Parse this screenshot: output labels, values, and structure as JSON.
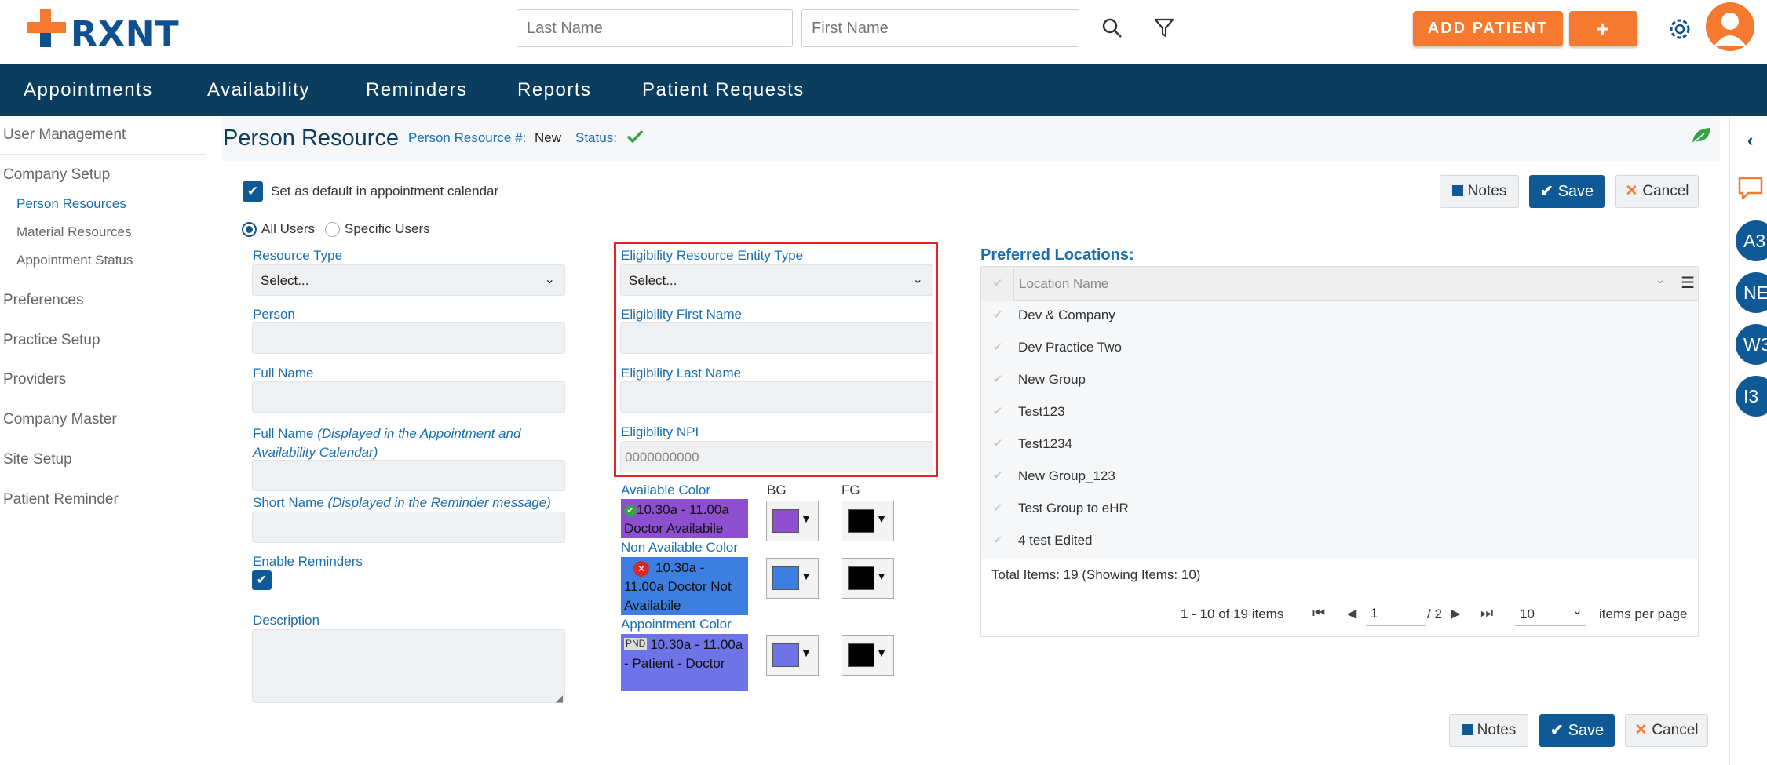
{
  "header": {
    "logo": "RXNT",
    "last_name_placeholder": "Last Name",
    "first_name_placeholder": "First Name",
    "add_patient": "ADD PATIENT",
    "plus": "+"
  },
  "nav": {
    "items": [
      "Appointments",
      "Availability",
      "Reminders",
      "Reports",
      "Patient Requests"
    ]
  },
  "sidebar": {
    "user_management": "User Management",
    "company_setup": "Company Setup",
    "person_resources": "Person Resources",
    "material_resources": "Material Resources",
    "appointment_status": "Appointment Status",
    "preferences": "Preferences",
    "practice_setup": "Practice Setup",
    "providers": "Providers",
    "company_master": "Company Master",
    "site_setup": "Site Setup",
    "patient_reminder": "Patient Reminder"
  },
  "page": {
    "title": "Person Resource",
    "resource_no_label": "Person Resource #:",
    "resource_no_value": "New",
    "status_label": "Status:",
    "status_color": "#3aa14a"
  },
  "form": {
    "default_calendar": "Set as default in appointment calendar",
    "all_users": "All Users",
    "specific_users": "Specific Users",
    "resource_type": "Resource Type",
    "resource_type_value": "Select...",
    "person": "Person",
    "full_name": "Full Name",
    "full_name_display": "Full Name",
    "full_name_display_note": "(Displayed in the Appointment and Availability Calendar)",
    "short_name": "Short Name",
    "short_name_note": "(Displayed in the Reminder message)",
    "enable_reminders": "Enable Reminders",
    "description": "Description"
  },
  "eligibility": {
    "entity_type": "Eligibility Resource Entity Type",
    "entity_type_value": "Select...",
    "first_name": "Eligibility First Name",
    "last_name": "Eligibility Last Name",
    "npi": "Eligibility NPI",
    "npi_placeholder": "0000000000"
  },
  "colors": {
    "bg_label": "BG",
    "fg_label": "FG",
    "available_label": "Available Color",
    "available_text": "10.30a - 11.00a Doctor Availabile",
    "available_bg": "#8e4ed0",
    "available_fg": "#000000",
    "non_available_label": "Non Available Color",
    "non_available_text": "10.30a - 11.00a Doctor Not Availabile",
    "non_available_bg": "#3d7fe0",
    "non_available_fg": "#000000",
    "appointment_label": "Appointment Color",
    "appointment_badge": "PND",
    "appointment_text": "10.30a - 11.00a - Patient - Doctor",
    "appointment_bg": "#6f73e8",
    "appointment_fg": "#000000"
  },
  "locations": {
    "title": "Preferred Locations:",
    "column": "Location Name",
    "rows": [
      "Dev & Company",
      "Dev Practice Two",
      "New Group",
      "Test123",
      "Test1234",
      "New Group_123",
      "Test Group to eHR",
      "4 test Edited"
    ],
    "total": "Total Items: 19 (Showing Items: 10)",
    "range": "1 - 10 of 19 items",
    "page": "1",
    "page_total": "/ 2",
    "page_size": "10",
    "per_page": "items per page"
  },
  "buttons": {
    "notes": "Notes",
    "save": "Save",
    "cancel": "Cancel"
  },
  "right_rail": {
    "circles": [
      "A3",
      "NE",
      "W3",
      "I3"
    ]
  }
}
